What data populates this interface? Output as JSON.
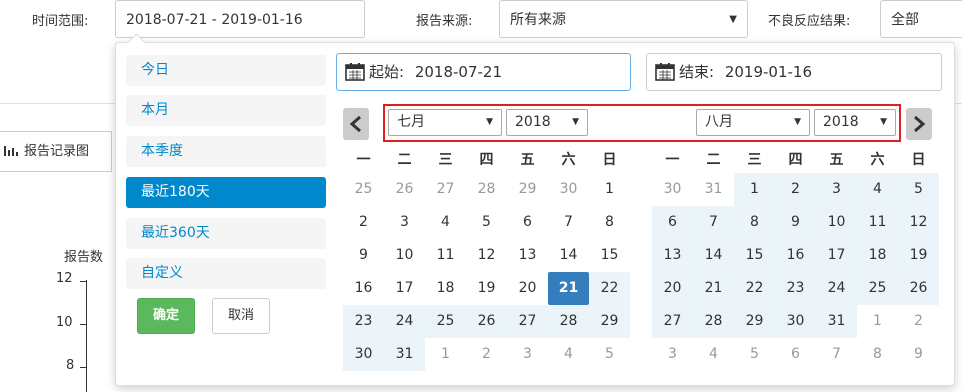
{
  "filters": {
    "time_label": "时间范围:",
    "time_value": "2018-07-21 - 2019-01-16",
    "source_label": "报告来源:",
    "source_value": "所有来源",
    "result_label": "不良反应结果:",
    "result_value": "全部"
  },
  "background": {
    "tab_label": "报告记录图",
    "y_title": "报告数",
    "y_ticks": [
      "12",
      "10",
      "8"
    ]
  },
  "picker": {
    "ranges": [
      "今日",
      "本月",
      "本季度",
      "最近180天",
      "最近360天",
      "自定义"
    ],
    "active_range": "最近180天",
    "ok_label": "确定",
    "cancel_label": "取消",
    "start_label": "起始:",
    "start_value": "2018-07-21",
    "end_label": "结束:",
    "end_value": "2019-01-16",
    "weekdays": [
      "一",
      "二",
      "三",
      "四",
      "五",
      "六",
      "日"
    ],
    "left": {
      "month": "七月",
      "year": "2018",
      "days": [
        [
          "25",
          "26",
          "27",
          "28",
          "29",
          "30",
          "1"
        ],
        [
          "2",
          "3",
          "4",
          "5",
          "6",
          "7",
          "8"
        ],
        [
          "9",
          "10",
          "11",
          "12",
          "13",
          "14",
          "15"
        ],
        [
          "16",
          "17",
          "18",
          "19",
          "20",
          "21",
          "22"
        ],
        [
          "23",
          "24",
          "25",
          "26",
          "27",
          "28",
          "29"
        ],
        [
          "30",
          "31",
          "1",
          "2",
          "3",
          "4",
          "5"
        ]
      ]
    },
    "right": {
      "month": "八月",
      "year": "2018",
      "days": [
        [
          "30",
          "31",
          "1",
          "2",
          "3",
          "4",
          "5"
        ],
        [
          "6",
          "7",
          "8",
          "9",
          "10",
          "11",
          "12"
        ],
        [
          "13",
          "14",
          "15",
          "16",
          "17",
          "18",
          "19"
        ],
        [
          "20",
          "21",
          "22",
          "23",
          "24",
          "25",
          "26"
        ],
        [
          "27",
          "28",
          "29",
          "30",
          "31",
          "1",
          "2"
        ],
        [
          "3",
          "4",
          "5",
          "6",
          "7",
          "8",
          "9"
        ]
      ]
    }
  },
  "colors": {
    "accent": "#0088cc",
    "selected_day": "#357ebd",
    "in_range": "#ebf4f8",
    "ok_button": "#5cb85c",
    "highlight_box": "#e02020"
  }
}
